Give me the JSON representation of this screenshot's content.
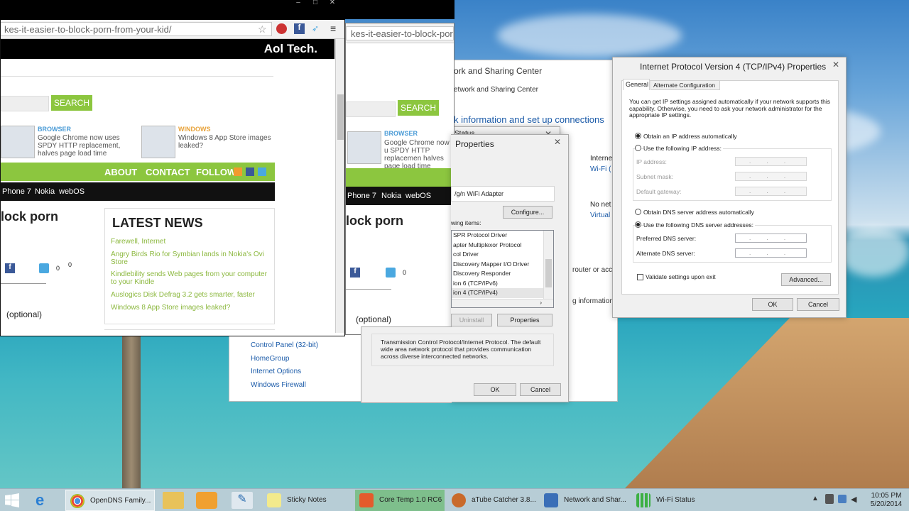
{
  "colors": {
    "green": "#8cc63f",
    "link_blue": "#4a9bd6",
    "news_green": "#8cb83f",
    "orange": "#e8a33b",
    "titlebar": "#000000"
  },
  "browser1": {
    "url": "kes-it-easier-to-block-porn-from-your-kid/",
    "aol_logo": "Aol Tech.",
    "search_label": "SEARCH",
    "related": [
      {
        "category": "BROWSER",
        "text": "Google Chrome now uses SPDY HTTP replacement, halves page load time"
      },
      {
        "category": "WINDOWS",
        "text": "Windows 8 App Store images leaked?"
      }
    ],
    "nav": [
      "ABOUT",
      "CONTACT",
      "FOLLOW"
    ],
    "topics": [
      "Phone 7",
      "Nokia",
      "webOS"
    ],
    "headline_fragment": "lock porn",
    "share_count_1": "0",
    "share_count_2": "0",
    "optional_label": "(optional)",
    "latest_news_title": "LATEST NEWS",
    "latest_news": [
      "Farewell, Internet",
      "Angry Birds Rio for Symbian lands in Nokia's Ovi Store",
      "Kindlebility sends Web pages from your computer to your Kindle",
      "Auslogics Disk Defrag 3.2 gets smarter, faster",
      "Windows 8 App Store images leaked?"
    ]
  },
  "browser2": {
    "url": "kes-it-easier-to-block-porn-",
    "search_label": "SEARCH",
    "related_category": "BROWSER",
    "related_text": "Google Chrome now u SPDY HTTP replacemen halves page load time",
    "topics": [
      "Phone 7",
      "Nokia",
      "webOS"
    ],
    "headline_fragment": "lock porn",
    "share_count": "0",
    "optional_label": "(optional)"
  },
  "nsc": {
    "title": "ork and Sharing Center",
    "breadcrumb": "etwork and Sharing Center",
    "heading": "k information and set up connections",
    "status_label": "Status",
    "internet_label": "Interne",
    "wifi_link": "Wi-Fi (",
    "no_net": "No net",
    "virtual_link": "Virtual",
    "router_text": "router or acce",
    "info_text": "g information",
    "see_also": [
      "Control Panel (32-bit)",
      "HomeGroup",
      "Internet Options",
      "Windows Firewall"
    ]
  },
  "wifi_props": {
    "title": "Properties",
    "adapter": "/g/n WiFi Adapter",
    "configure": "Configure...",
    "items_label": "wing items:",
    "items": [
      "SPR Protocol Driver",
      "apter Multiplexor Protocol",
      "col Driver",
      "Discovery Mapper I/O Driver",
      "Discovery Responder",
      "ion 6 (TCP/IPv6)",
      "ion 4 (TCP/IPv4)"
    ],
    "uninstall": "Uninstall",
    "properties": "Properties",
    "description": "Transmission Control Protocol/Internet Protocol. The default wide area network protocol that provides communication across diverse interconnected networks.",
    "ok": "OK",
    "cancel": "Cancel"
  },
  "ipv4": {
    "title": "Internet Protocol Version 4 (TCP/IPv4) Properties",
    "tabs": [
      "General",
      "Alternate Configuration"
    ],
    "intro": "You can get IP settings assigned automatically if your network supports this capability. Otherwise, you need to ask your network administrator for the appropriate IP settings.",
    "auto_ip": "Obtain an IP address automatically",
    "manual_ip": "Use the following IP address:",
    "ip_address": "IP address:",
    "subnet": "Subnet mask:",
    "gateway": "Default gateway:",
    "auto_dns": "Obtain DNS server address automatically",
    "manual_dns": "Use the following DNS server addresses:",
    "preferred_dns": "Preferred DNS server:",
    "alternate_dns": "Alternate DNS server:",
    "ip_dots": ". . .",
    "validate": "Validate settings upon exit",
    "advanced": "Advanced...",
    "ok": "OK",
    "cancel": "Cancel"
  },
  "taskbar": {
    "items": [
      {
        "label": "OpenDNS Family...",
        "icon": "chrome-icon"
      },
      {
        "label": "Sticky Notes",
        "icon": "sticky-notes-icon"
      },
      {
        "label": "Core Temp 1.0 RC6",
        "icon": "core-temp-icon"
      },
      {
        "label": "aTube Catcher 3.8...",
        "icon": "atube-icon"
      },
      {
        "label": "Network and Shar...",
        "icon": "network-icon"
      },
      {
        "label": "Wi-Fi Status",
        "icon": "wifi-icon"
      }
    ],
    "time": "10:05 PM",
    "date": "5/20/2014"
  }
}
